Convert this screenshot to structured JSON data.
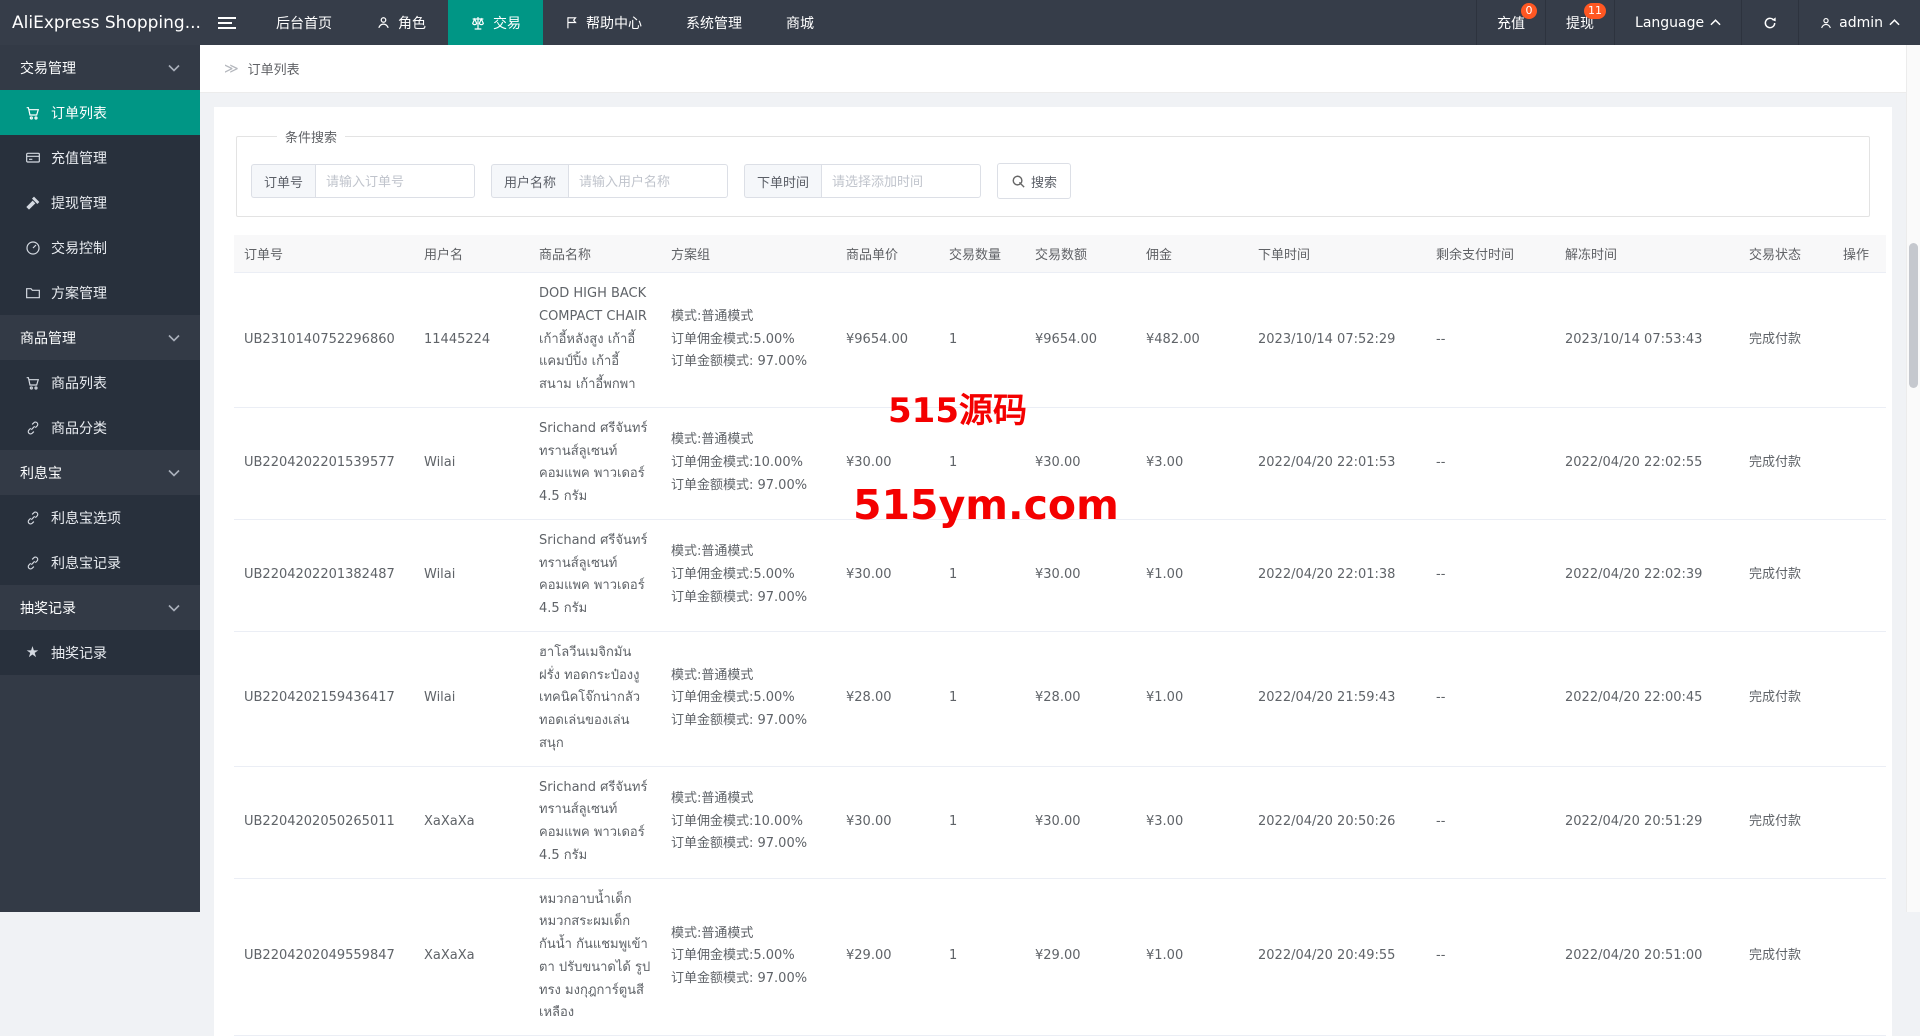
{
  "colors": {
    "accent": "#009685",
    "badge": "#ff5722",
    "watermark": "#f40000"
  },
  "topbar": {
    "logo": "AliExpress Shopping...",
    "menu": [
      {
        "label": "后台首页",
        "icon": ""
      },
      {
        "label": "角色",
        "icon": "user-icon"
      },
      {
        "label": "交易",
        "icon": "scale-icon",
        "active": true
      },
      {
        "label": "帮助中心",
        "icon": "flag-icon"
      },
      {
        "label": "系统管理",
        "icon": ""
      },
      {
        "label": "商城",
        "icon": ""
      }
    ],
    "recharge": {
      "label": "充值",
      "badge": "0"
    },
    "withdraw": {
      "label": "提现",
      "badge": "11"
    },
    "language_label": "Language",
    "username": "admin"
  },
  "sidebar": {
    "sections": [
      {
        "title": "交易管理",
        "items": [
          {
            "label": "订单列表",
            "icon": "cart-icon",
            "active": true
          },
          {
            "label": "充值管理",
            "icon": "card-icon"
          },
          {
            "label": "提现管理",
            "icon": "gavel-icon"
          },
          {
            "label": "交易控制",
            "icon": "gauge-icon"
          },
          {
            "label": "方案管理",
            "icon": "folder-icon"
          }
        ]
      },
      {
        "title": "商品管理",
        "items": [
          {
            "label": "商品列表",
            "icon": "cart-icon"
          },
          {
            "label": "商品分类",
            "icon": "link-icon"
          }
        ]
      },
      {
        "title": "利息宝",
        "items": [
          {
            "label": "利息宝选项",
            "icon": "link-icon"
          },
          {
            "label": "利息宝记录",
            "icon": "link-icon"
          }
        ]
      },
      {
        "title": "抽奖记录",
        "items": [
          {
            "label": "抽奖记录",
            "icon": "star-icon"
          }
        ]
      }
    ]
  },
  "breadcrumb": {
    "icon": "≫",
    "label": "订单列表"
  },
  "search": {
    "legend": "条件搜索",
    "fields": [
      {
        "label": "订单号",
        "placeholder": "请输入订单号"
      },
      {
        "label": "用户名称",
        "placeholder": "请输入用户名称"
      },
      {
        "label": "下单时间",
        "placeholder": "请选择添加时间"
      }
    ],
    "button": "搜索"
  },
  "table": {
    "columns": [
      "订单号",
      "用户名",
      "商品名称",
      "方案组",
      "商品单价",
      "交易数量",
      "交易数额",
      "佣金",
      "下单时间",
      "剩余支付时间",
      "解冻时间",
      "交易状态",
      "操作"
    ],
    "rows": [
      {
        "order_no": "UB2310140752296860",
        "username": "11445224",
        "product": "DOD HIGH BACK COMPACT CHAIR เก้าอี้หลังสูง เก้าอี้แคมป์ปิ้ง เก้าอี้สนาม เก้าอี้พกพา",
        "plan": [
          "模式:普通模式",
          "订单佣金模式:5.00%",
          "订单金额模式: 97.00%"
        ],
        "unit_price": "¥9654.00",
        "qty": "1",
        "amount": "¥9654.00",
        "commission": "¥482.00",
        "order_time": "2023/10/14 07:52:29",
        "remaining": "--",
        "unfreeze_time": "2023/10/14 07:53:43",
        "status": "完成付款",
        "action": ""
      },
      {
        "order_no": "UB2204202201539577",
        "username": "Wilai",
        "product": "Srichand ศรีจันทร์ ทรานส์ลูเซนท์ คอมแพค พาวเดอร์ 4.5 กรัม",
        "plan": [
          "模式:普通模式",
          "订单佣金模式:10.00%",
          "订单金额模式: 97.00%"
        ],
        "unit_price": "¥30.00",
        "qty": "1",
        "amount": "¥30.00",
        "commission": "¥3.00",
        "order_time": "2022/04/20 22:01:53",
        "remaining": "--",
        "unfreeze_time": "2022/04/20 22:02:55",
        "status": "完成付款",
        "action": ""
      },
      {
        "order_no": "UB2204202201382487",
        "username": "Wilai",
        "product": "Srichand ศรีจันทร์ ทรานส์ลูเซนท์ คอมแพค พาวเดอร์ 4.5 กรัม",
        "plan": [
          "模式:普通模式",
          "订单佣金模式:5.00%",
          "订单金额模式: 97.00%"
        ],
        "unit_price": "¥30.00",
        "qty": "1",
        "amount": "¥30.00",
        "commission": "¥1.00",
        "order_time": "2022/04/20 22:01:38",
        "remaining": "--",
        "unfreeze_time": "2022/04/20 22:02:39",
        "status": "完成付款",
        "action": ""
      },
      {
        "order_no": "UB2204202159436417",
        "username": "Wilai",
        "product": "ฮาโลวีนเมจิกมันฝรั่ง ทอดกระป๋องงู เทคนิคโจ๊กน่ากลัว ทอดเล่นของเล่น สนุก",
        "plan": [
          "模式:普通模式",
          "订单佣金模式:5.00%",
          "订单金额模式: 97.00%"
        ],
        "unit_price": "¥28.00",
        "qty": "1",
        "amount": "¥28.00",
        "commission": "¥1.00",
        "order_time": "2022/04/20 21:59:43",
        "remaining": "--",
        "unfreeze_time": "2022/04/20 22:00:45",
        "status": "完成付款",
        "action": ""
      },
      {
        "order_no": "UB2204202050265011",
        "username": "XaXaXa",
        "product": "Srichand ศรีจันทร์ ทรานส์ลูเซนท์ คอมแพค พาวเดอร์ 4.5 กรัม",
        "plan": [
          "模式:普通模式",
          "订单佣金模式:10.00%",
          "订单金额模式: 97.00%"
        ],
        "unit_price": "¥30.00",
        "qty": "1",
        "amount": "¥30.00",
        "commission": "¥3.00",
        "order_time": "2022/04/20 20:50:26",
        "remaining": "--",
        "unfreeze_time": "2022/04/20 20:51:29",
        "status": "完成付款",
        "action": ""
      },
      {
        "order_no": "UB2204202049559847",
        "username": "XaXaXa",
        "product": "หมวกอาบน้ำเด็ก หมวกสระผมเด็ก กันน้ำ กันแชมพูเข้าตา ปรับขนาดได้ รูปทรง มงกุฎการ์ตูนสีเหลือง",
        "plan": [
          "模式:普通模式",
          "订单佣金模式:5.00%",
          "订单金额模式: 97.00%"
        ],
        "unit_price": "¥29.00",
        "qty": "1",
        "amount": "¥29.00",
        "commission": "¥1.00",
        "order_time": "2022/04/20 20:49:55",
        "remaining": "--",
        "unfreeze_time": "2022/04/20 20:51:00",
        "status": "完成付款",
        "action": ""
      }
    ]
  },
  "watermarks": [
    "515源码",
    "515ym.com"
  ]
}
